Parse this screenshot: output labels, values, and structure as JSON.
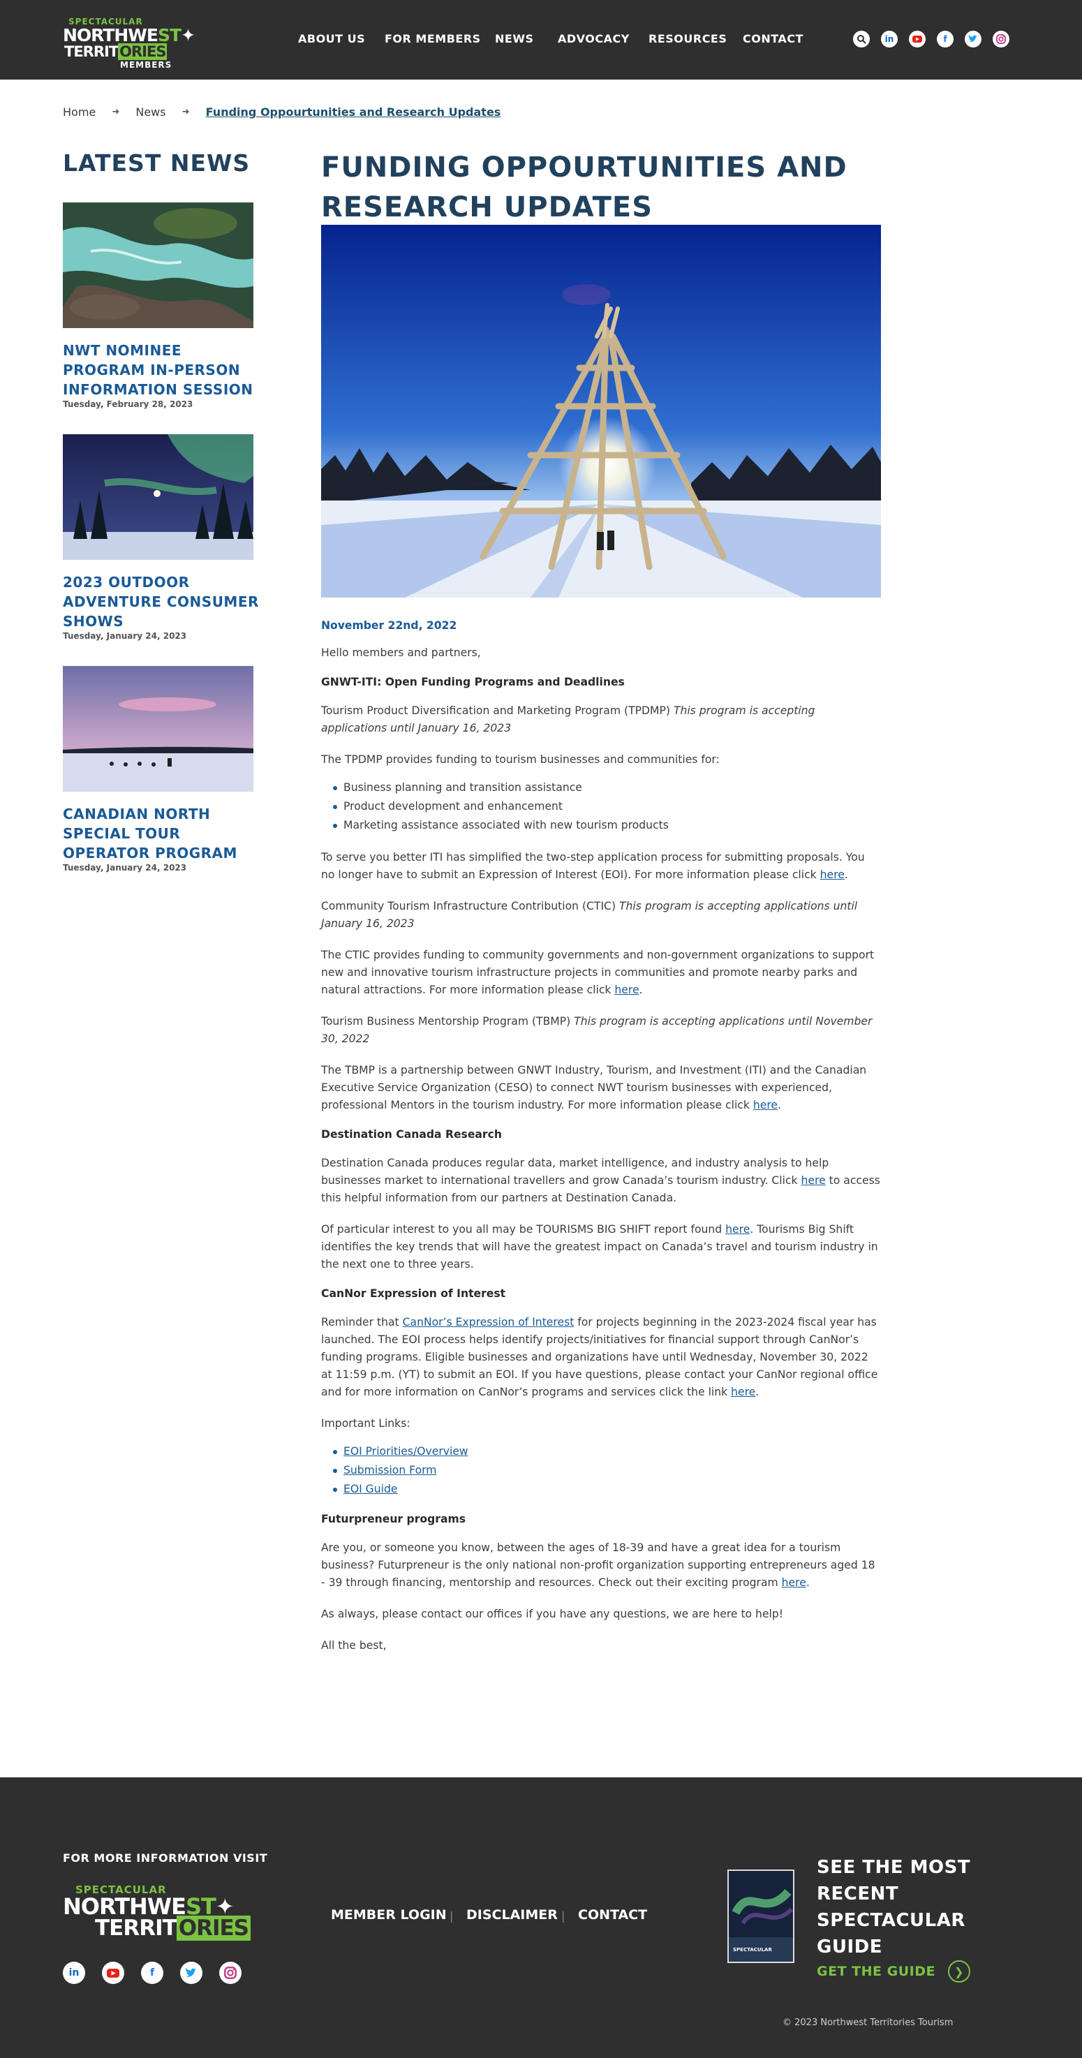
{
  "header": {
    "logo": {
      "line1": "SPECTACULAR",
      "line2a": "NORTHWE",
      "line2b": "ST",
      "line3a": "TERRIT",
      "line3b": "ORIES",
      "line4": "MEMBERS"
    },
    "nav": [
      "ABOUT US",
      "FOR MEMBERS",
      "NEWS",
      "ADVOCACY",
      "RESOURCES",
      "CONTACT"
    ],
    "icons": [
      "search-icon",
      "linkedin-icon",
      "youtube-icon",
      "facebook-icon",
      "twitter-icon",
      "instagram-icon"
    ]
  },
  "breadcrumb": {
    "home": "Home",
    "news": "News",
    "current": "Funding Oppourtunities and Research Updates"
  },
  "sidebar": {
    "title": "LATEST NEWS",
    "items": [
      {
        "title": "NWT NOMINEE PROGRAM IN-PERSON INFORMATION SESSION",
        "date": "Tuesday, February 28, 2023"
      },
      {
        "title": "2023 OUTDOOR ADVENTURE CONSUMER SHOWS",
        "date": "Tuesday, January 24, 2023"
      },
      {
        "title": "CANADIAN NORTH SPECIAL TOUR OPERATOR PROGRAM",
        "date": "Tuesday, January 24, 2023"
      }
    ]
  },
  "article": {
    "title": "FUNDING OPPOURTUNITIES AND RESEARCH UPDATES",
    "date": "November 22nd, 2022",
    "greeting": "Hello members and partners,",
    "h_gnwt": "GNWT-ITI: Open Funding Programs and Deadlines",
    "tpdmp_name": "Tourism Product Diversification and Marketing Program (TPDMP)",
    "tpdmp_note": "This program is accepting applications until January 16, 2023",
    "tpdmp_intro": "The TPDMP provides funding to tourism businesses and communities for:",
    "tpdmp_list": [
      "Business planning and transition assistance",
      "Product development and enhancement",
      "Marketing assistance associated with new tourism products"
    ],
    "iti_text": "To serve you better ITI has simplified the two-step application process for submitting proposals. You no longer have to submit an Expression of Interest (EOI). For more information please click",
    "link_here": "here",
    "ctic_name": "Community Tourism Infrastructure Contribution (CTIC)",
    "ctic_note": "This program is accepting applications until January 16, 2023",
    "ctic_text": "The CTIC provides funding to community governments and non-government organizations to support new and innovative tourism infrastructure projects in communities and promote nearby parks and natural attractions. For more information please click",
    "tbmp_name": "Tourism Business Mentorship Program (TBMP)",
    "tbmp_note": "This program is accepting applications until November 30, 2022",
    "tbmp_text": "The TBMP is a partnership between GNWT Industry, Tourism, and Investment (ITI) and the Canadian Executive Service Organization (CESO) to connect NWT tourism businesses with experienced, professional Mentors in the tourism industry. For more information please click",
    "h_dc": "Destination Canada Research",
    "dc_text_a": "Destination Canada produces regular data, market intelligence, and industry analysis to help businesses market to international travellers and grow Canada’s tourism industry. Click",
    "dc_text_b": "to access this helpful information from our partners at Destination Canada.",
    "shift_text_a": "Of particular interest to you all may be TOURISMS BIG SHIFT report found",
    "shift_text_b": ". Tourisms Big Shift identifies the key trends that will have the greatest impact on Canada’s travel and tourism industry in the next one to three years.",
    "h_cannor": "CanNor Expression of Interest",
    "cannor_a": "Reminder that",
    "cannor_link": "CanNor’s Expression of Interest",
    "cannor_b": "for projects beginning in the 2023-2024 fiscal year has launched. The EOI process helps identify projects/initiatives for financial support through CanNor’s funding programs. Eligible businesses and organizations have until Wednesday, November 30, 2022 at 11:59 p.m. (YT) to submit an EOI. If you have questions, please contact your CanNor regional office and for more information on CanNor’s programs and services click the link",
    "important": "Important Links:",
    "links": [
      "EOI Priorities/Overview",
      "Submission Form",
      "EOI Guide"
    ],
    "h_futur": "Futurpreneur programs",
    "futur_text": "Are you, or someone you know, between the ages of 18-39 and have a great idea for a tourism business? Futurpreneur is the only national non-profit organization supporting entrepreneurs aged 18 - 39 through financing, mentorship and resources. Check out their exciting program",
    "closing": "As always, please contact our offices if you have any questions, we are here to help!",
    "signoff": "All the best,"
  },
  "footer": {
    "info": "FOR MORE INFORMATION VISIT",
    "logo": {
      "line1": "SPECTACULAR",
      "line2a": "NORTHWE",
      "line2b": "ST",
      "line3a": "TERRIT",
      "line3b": "ORIES"
    },
    "links": [
      "MEMBER LOGIN",
      "DISCLAIMER",
      "CONTACT"
    ],
    "divider": "|",
    "social": [
      "linkedin-icon",
      "youtube-icon",
      "facebook-icon",
      "twitter-icon",
      "instagram-icon"
    ],
    "guide_title": "SEE THE MOST RECENT SPECTACULAR GUIDE",
    "guide_link": "GET THE GUIDE",
    "guide_cover_text": "SPECTACULAR",
    "copyright": "© 2023 Northwest Territories Tourism"
  },
  "colors": {
    "header_bg": "#2f2f2f",
    "accent_green": "#7cc243",
    "link_blue": "#1a5a96",
    "heading_navy": "#21415d"
  }
}
